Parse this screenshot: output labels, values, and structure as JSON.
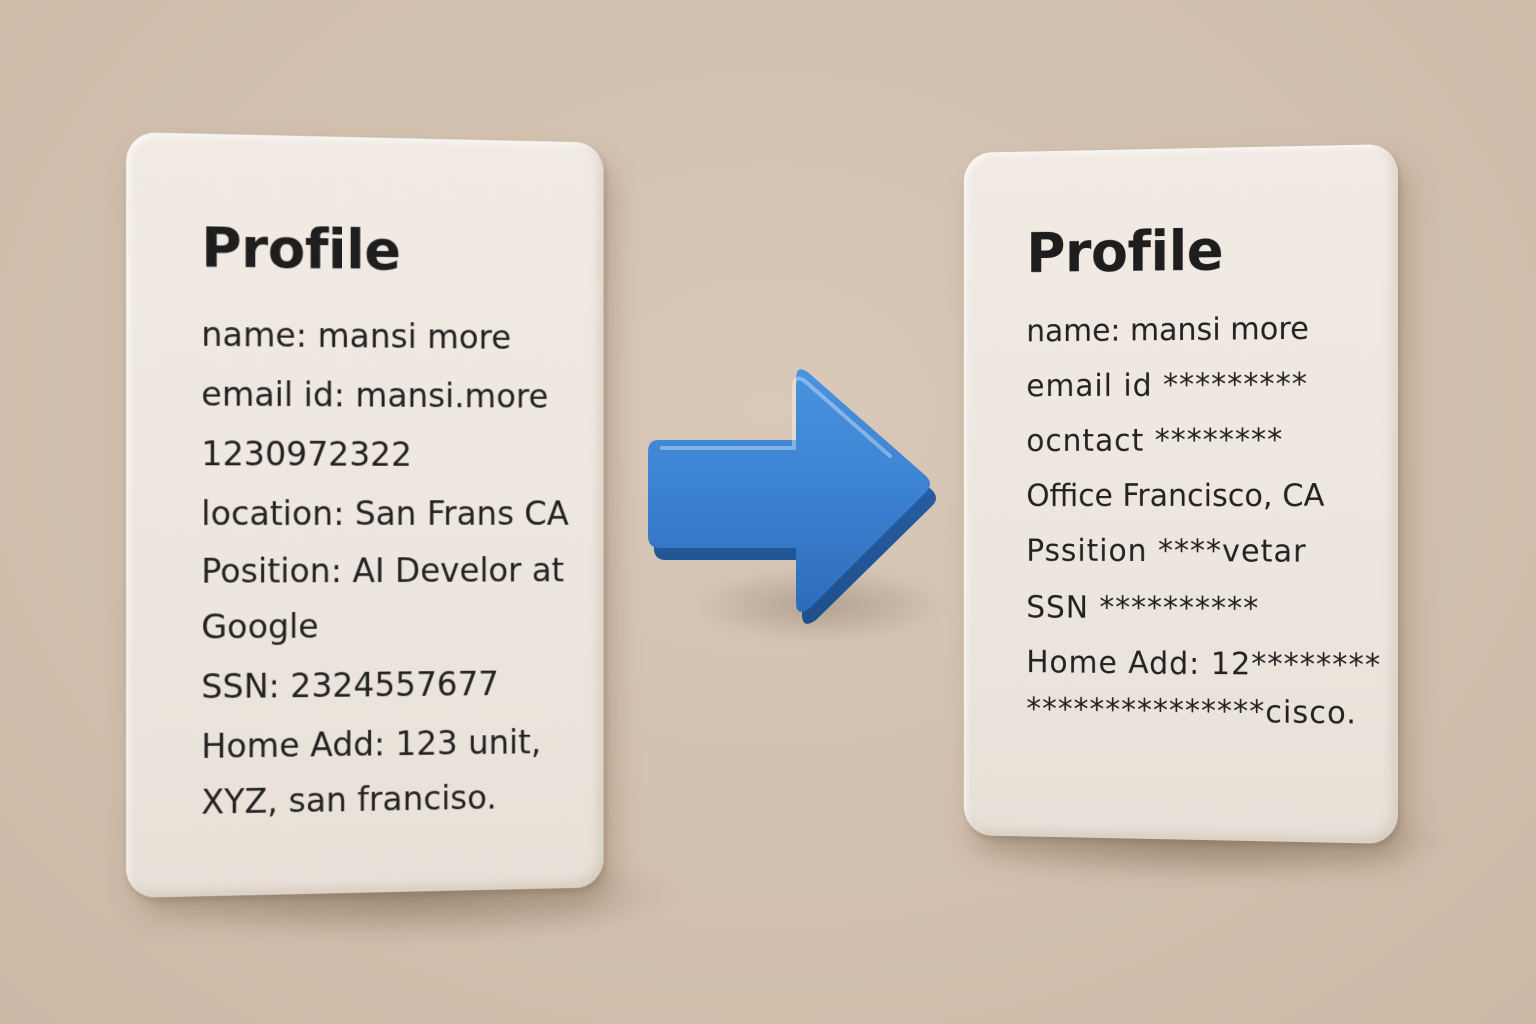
{
  "colors": {
    "background": "#d2c0ae",
    "card": "#ede6de",
    "text": "#1f1f1f",
    "arrow": "#3b82d0"
  },
  "arrow": {
    "icon": "right-arrow-icon"
  },
  "original_profile": {
    "title": "Profile",
    "lines": [
      "name:  mansi more",
      "email id: mansi.more",
      "1230972322",
      "location: San Frans CA",
      "Position: AI Develor at",
      "Google",
      "SSN: 2324557677",
      "Home Add: 123 unit,",
      "XYZ, san franciso."
    ]
  },
  "masked_profile": {
    "title": "Profile",
    "lines": [
      "name: mansi  more",
      "email id   *********",
      "ocntact   ********",
      "Office Francisco, CA",
      "Pssition   ****vetar",
      "SSN    **********",
      "Home Add:  12********",
      "***************cisco."
    ]
  }
}
